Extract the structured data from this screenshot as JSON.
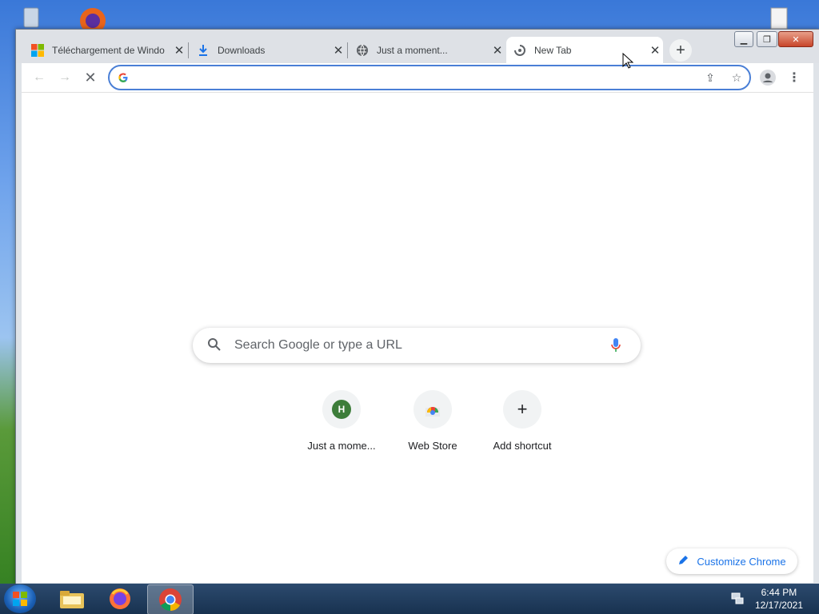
{
  "tabs": [
    {
      "title": "Téléchargement de Windo",
      "icon": "microsoft-logo-icon"
    },
    {
      "title": "Downloads",
      "icon": "download-icon"
    },
    {
      "title": "Just a moment...",
      "icon": "globe-icon"
    },
    {
      "title": "New Tab",
      "icon": "loading-icon"
    }
  ],
  "omnibox": {
    "value": "",
    "placeholder": ""
  },
  "search": {
    "placeholder": "Search Google or type a URL"
  },
  "shortcuts": [
    {
      "label": "Just a mome...",
      "letter": "H"
    },
    {
      "label": "Web Store"
    },
    {
      "label": "Add shortcut"
    }
  ],
  "customize_label": "Customize Chrome",
  "clock": {
    "time": "6:44 PM",
    "date": "12/17/2021"
  },
  "colors": {
    "accent": "#1a73e8",
    "tabstrip": "#dee1e6"
  }
}
